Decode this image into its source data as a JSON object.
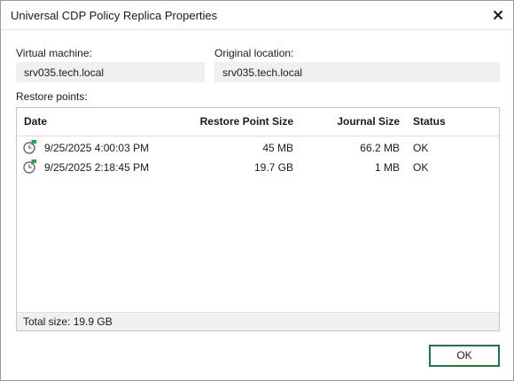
{
  "window": {
    "title": "Universal CDP Policy Replica Properties"
  },
  "vm": {
    "label": "Virtual machine:",
    "value": "srv035.tech.local"
  },
  "location": {
    "label": "Original location:",
    "value": "srv035.tech.local"
  },
  "restore": {
    "label": "Restore points:",
    "columns": {
      "date": "Date",
      "size": "Restore Point Size",
      "journal": "Journal Size",
      "status": "Status"
    },
    "rows": [
      {
        "date": "9/25/2025 4:00:03 PM",
        "size": "45 MB",
        "journal": "66.2 MB",
        "status": "OK",
        "icon": "restore-point-clock-icon"
      },
      {
        "date": "9/25/2025 2:18:45 PM",
        "size": "19.7 GB",
        "journal": "1 MB",
        "status": "OK",
        "icon": "restore-point-clock-icon"
      }
    ],
    "total": "Total size: 19.9 GB"
  },
  "buttons": {
    "ok": "OK"
  },
  "colors": {
    "accent": "#1e7a3e",
    "flag": "#2aa34a",
    "field_bg": "#f0f0f0"
  }
}
